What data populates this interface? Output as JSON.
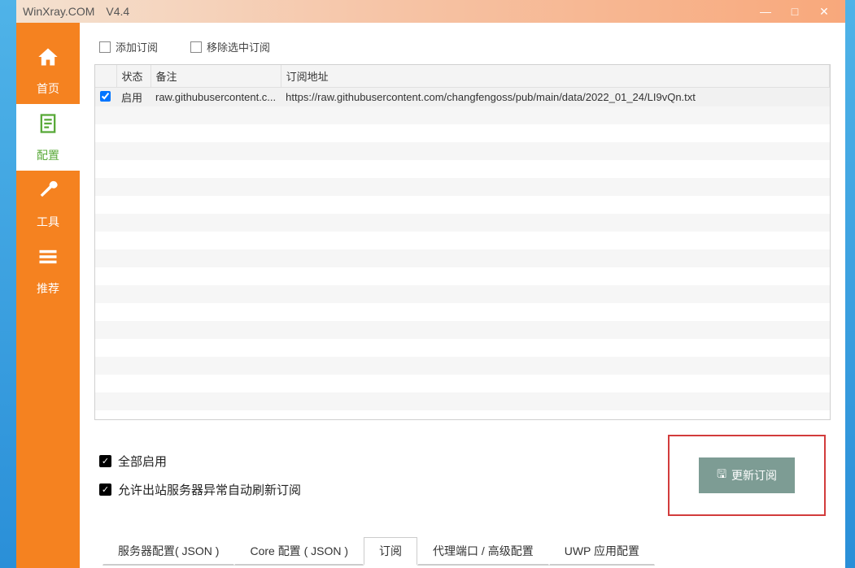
{
  "window": {
    "title": "WinXray.COM　V4.4"
  },
  "sidebar": {
    "items": [
      {
        "label": "首页"
      },
      {
        "label": "配置"
      },
      {
        "label": "工具"
      },
      {
        "label": "推荐"
      }
    ]
  },
  "toolbar": {
    "add_label": "添加订阅",
    "remove_label": "移除选中订阅"
  },
  "table": {
    "headers": {
      "checkbox": "",
      "status": "状态",
      "remark": "备注",
      "url": "订阅地址"
    },
    "rows": [
      {
        "checked": true,
        "status": "启用",
        "remark": "raw.githubusercontent.c...",
        "url": "https://raw.githubusercontent.com/changfengoss/pub/main/data/2022_01_24/LI9vQn.txt"
      }
    ]
  },
  "checks": {
    "enable_all": "全部启用",
    "auto_refresh": "允许出站服务器异常自动刷新订阅"
  },
  "update_button": "更新订阅",
  "tabs": [
    {
      "label": "服务器配置( JSON )",
      "active": false
    },
    {
      "label": "Core 配置 ( JSON )",
      "active": false
    },
    {
      "label": "订阅",
      "active": true
    },
    {
      "label": "代理端口 / 高级配置",
      "active": false
    },
    {
      "label": "UWP 应用配置",
      "active": false
    }
  ]
}
